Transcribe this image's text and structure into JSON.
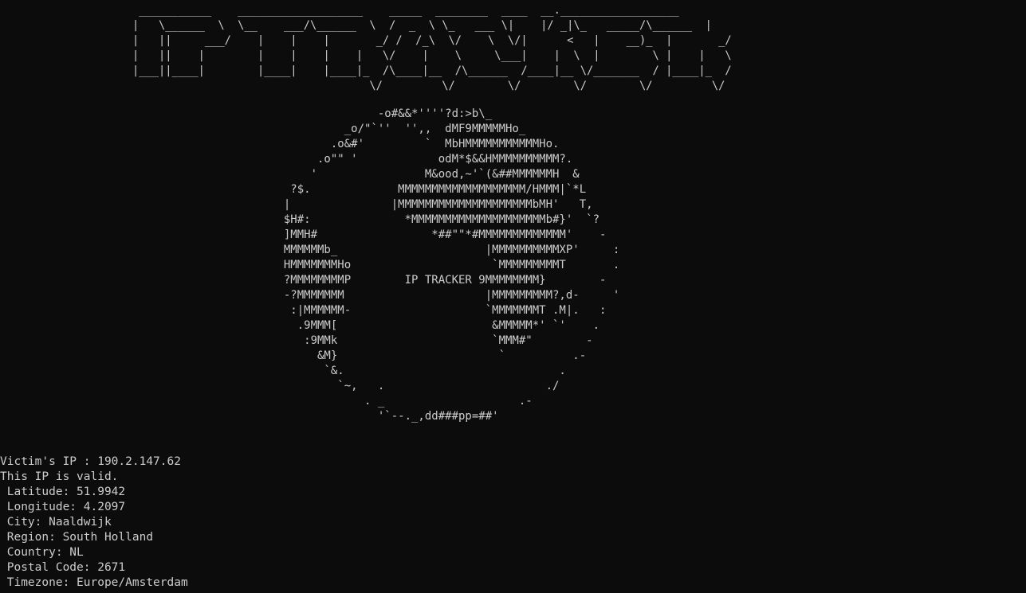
{
  "banner": {
    "lines": [
      " ___________    ___________________    _____  ________  ____  __.__________________",
      "|   \\______  \\  \\__    ___/\\______  \\  /  _  \\ \\_   ___ \\|    |/ _|\\_   _____/\\______  |",
      "|   ||     ___/    |    |    |       _/ /  /_\\  \\/    \\  \\/|      <   |    __)_  |       _/",
      "|   ||    |        |    |    |    |   \\/    |    \\     \\___|    |  \\  |        \\ |    |   \\",
      "|___||____|        |____|    |____|_  /\\____|__  /\\______  /____|__ \\/_______  / |____|_  /",
      "                                    \\/         \\/        \\/        \\/        \\/         \\/"
    ]
  },
  "globe": {
    "lines": [
      "                -o#&&*''''?d:>b\\_",
      "           _o/\"`''  '',,  dMF9MMMMMHo_",
      "         .o&#'         `  MbHMMMMMMMMMMMHo.",
      "       .o\"\" '            odM*$&&HMMMMMMMMMM?.",
      "      '                M&ood,~'`(&##MMMMMMH  &",
      "   ?$.             MMMMMMMMMMMMMMMMMMM/HMMM|`*L",
      "  |               |MMMMMMMMMMMMMMMMMMMMbMH'   T,",
      "  $H#:              *MMMMMMMMMMMMMMMMMMMMb#}'  `?",
      "  ]MMH#                 *##\"\"*#MMMMMMMMMMMMM'    -",
      "  MMMMMMb_                      |MMMMMMMMMMXP'     :",
      "  HMMMMMMMHo                     `MMMMMMMMMT       .",
      "  ?MMMMMMMMP        IP TRACKER 9MMMMMMMM}        -",
      "  -?MMMMMMM                     |MMMMMMMMM?,d-     '",
      "   :|MMMMMM-                    `MMMMMMMT .M|.   :",
      "    .9MMM[                       &MMMMM*' `'    .",
      "     :9MMk                       `MMM#\"        -",
      "       &M}                        `          .-",
      "        `&.                                .",
      "          `~,   .                        ./",
      "              . _                    .-",
      "                '`--._,dd###pp=##'"
    ]
  },
  "output": {
    "victim_ip": "Victim's IP : 190.2.147.62",
    "valid": "This IP is valid.",
    "latitude": " Latitude: 51.9942",
    "longitude": " Longitude: 4.2097",
    "city": " City: Naaldwijk",
    "region": " Region: South Holland",
    "country": " Country: NL",
    "postal": " Postal Code: 2671",
    "timezone": " Timezone: Europe/Amsterdam"
  },
  "colors": {
    "background": "#0c0c0c",
    "text": "#cccccc"
  }
}
